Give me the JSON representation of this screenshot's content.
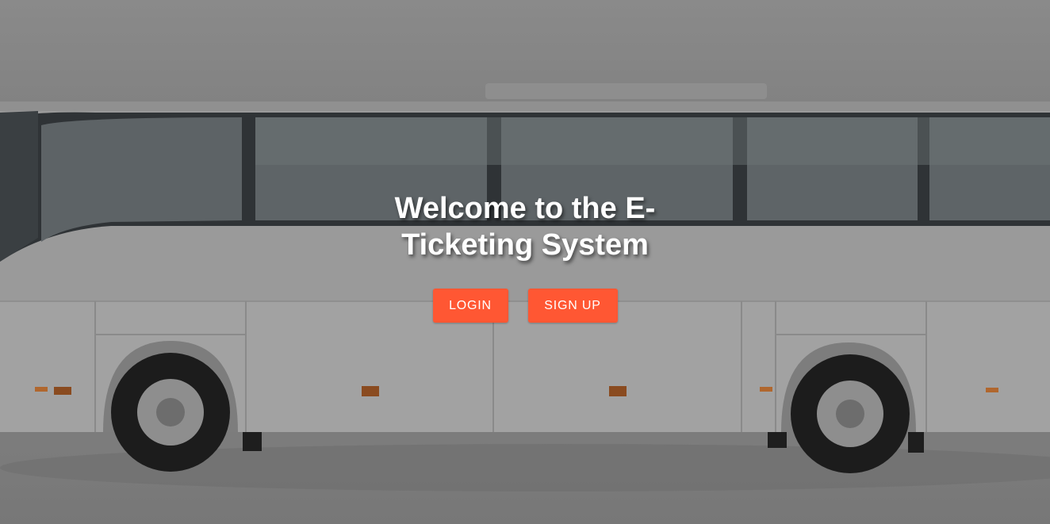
{
  "hero": {
    "title": "Welcome to the E-Ticketing System",
    "background_image": "bus-photo"
  },
  "actions": {
    "login_label": "LOGIN",
    "signup_label": "SIGN UP"
  },
  "colors": {
    "accent": "#ff5733",
    "overlay": "#7a7a7a",
    "text": "#ffffff"
  }
}
